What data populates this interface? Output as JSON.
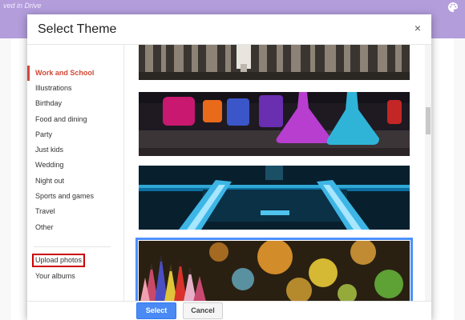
{
  "background": {
    "top_text": "ved in Drive"
  },
  "dialog": {
    "title": "Select Theme",
    "close_label": "×"
  },
  "sidebar": {
    "items": [
      {
        "label": "Work and School",
        "active": true
      },
      {
        "label": "Illustrations"
      },
      {
        "label": "Birthday"
      },
      {
        "label": "Food and dining"
      },
      {
        "label": "Party"
      },
      {
        "label": "Just kids"
      },
      {
        "label": "Wedding"
      },
      {
        "label": "Night out"
      },
      {
        "label": "Sports and games"
      },
      {
        "label": "Travel"
      },
      {
        "label": "Other"
      }
    ],
    "upload_label": "Upload photos",
    "albums_label": "Your albums"
  },
  "footer": {
    "select_label": "Select",
    "cancel_label": "Cancel"
  },
  "colors": {
    "active_red": "#d14836",
    "primary_blue": "#4a8af4",
    "header_purple": "#b39ddb"
  }
}
